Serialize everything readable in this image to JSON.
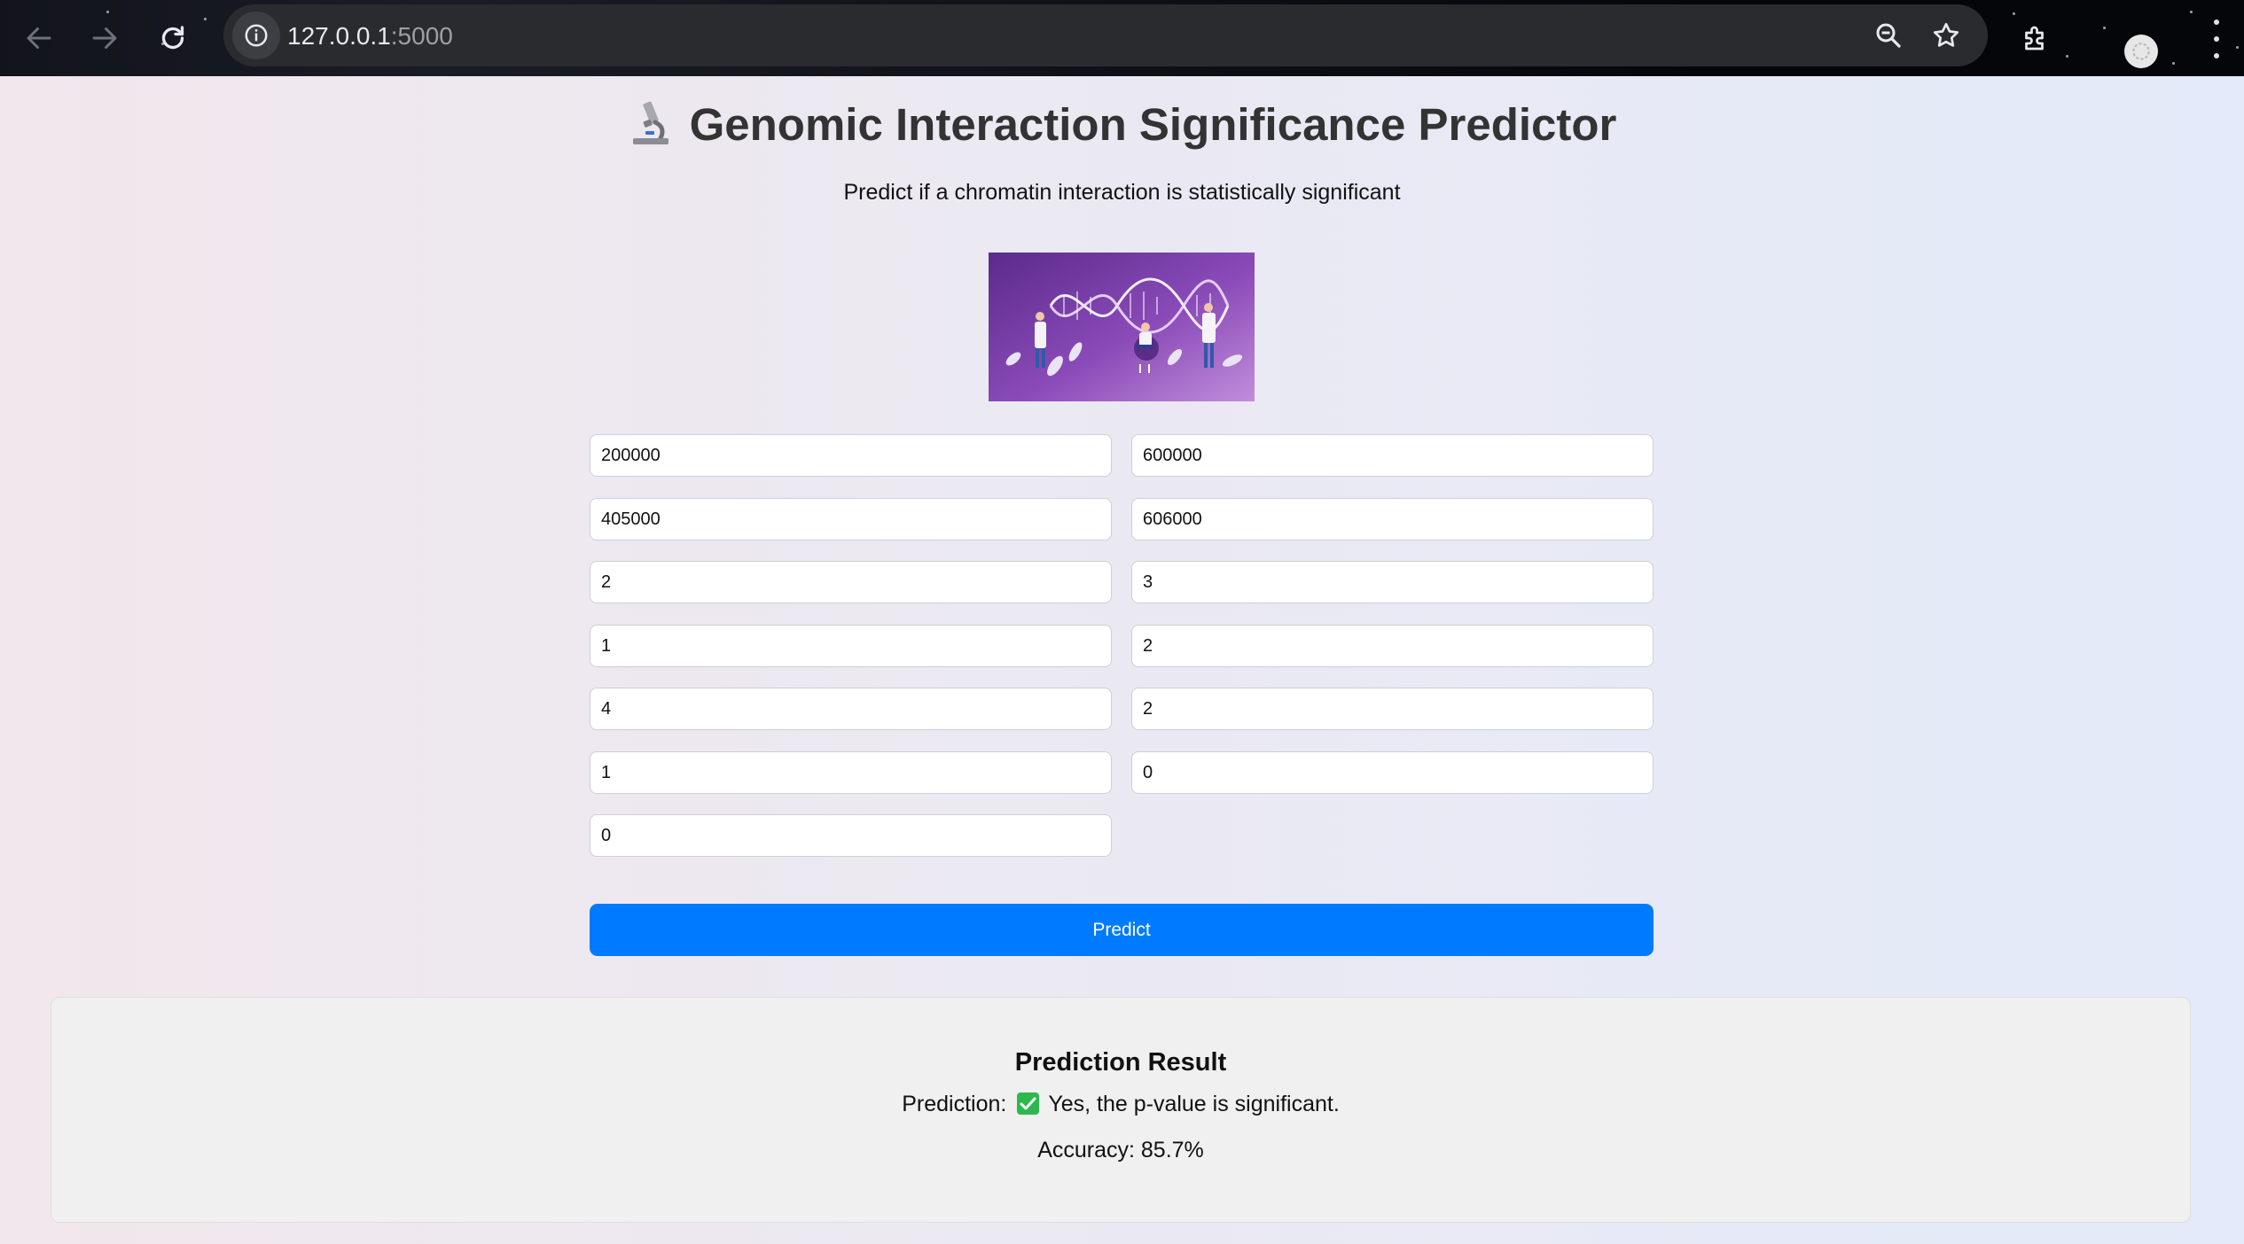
{
  "browser": {
    "url_host": "127.0.0.1",
    "url_port": ":5000",
    "icons": [
      "back-arrow-icon",
      "forward-arrow-icon",
      "reload-icon",
      "site-info-icon",
      "zoom-icon",
      "bookmark-star-icon",
      "extensions-icon",
      "profile-avatar-icon",
      "menu-icon"
    ]
  },
  "header": {
    "icon": "microscope-icon",
    "title": "Genomic Interaction Significance Predictor",
    "subtitle": "Predict if a chromatin interaction is statistically significant"
  },
  "hero_image": {
    "icon": "dna-researchers-illustration",
    "colors": [
      "#6a2f97",
      "#b77ed2"
    ]
  },
  "form": {
    "fields": [
      {
        "value": "200000"
      },
      {
        "value": "600000"
      },
      {
        "value": "405000"
      },
      {
        "value": "606000"
      },
      {
        "value": "2"
      },
      {
        "value": "3"
      },
      {
        "value": "1"
      },
      {
        "value": "2"
      },
      {
        "value": "4"
      },
      {
        "value": "2"
      },
      {
        "value": "1"
      },
      {
        "value": "0"
      },
      {
        "value": "0"
      }
    ],
    "submit_label": "Predict",
    "accent_color": "#007bff"
  },
  "result": {
    "heading": "Prediction Result",
    "prediction_label": "Prediction:",
    "prediction_icon": "green-check-icon",
    "prediction_text": "Yes, the p-value is significant.",
    "accuracy_text": "Accuracy: 85.7%"
  }
}
